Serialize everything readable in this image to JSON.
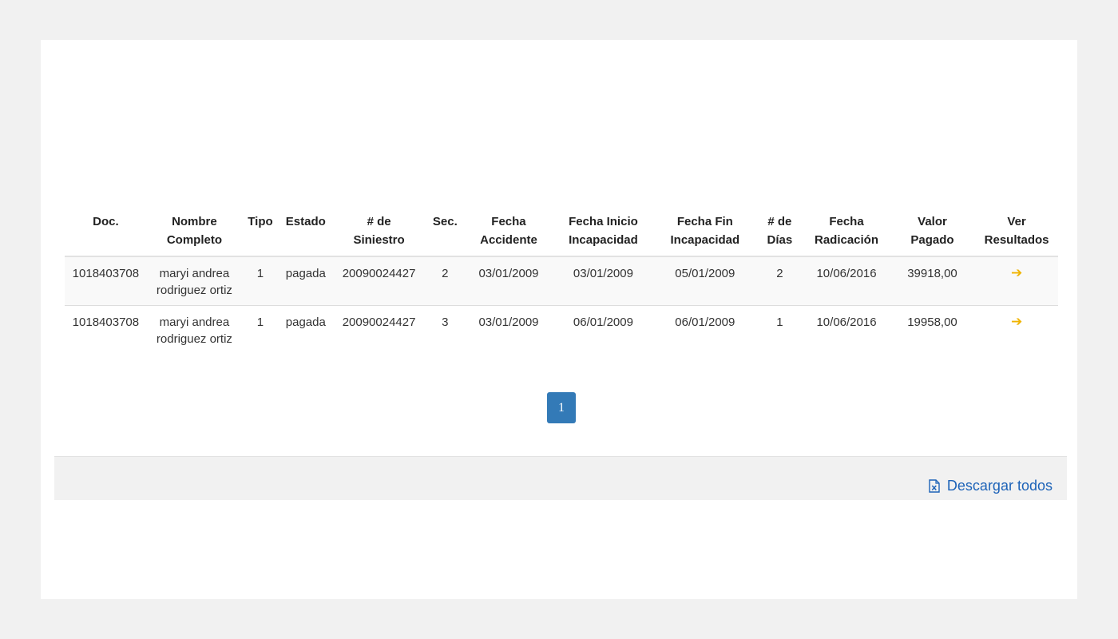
{
  "table": {
    "headers": [
      [
        "Doc.",
        ""
      ],
      [
        "Nombre",
        "Completo"
      ],
      [
        "Tipo",
        ""
      ],
      [
        "Estado",
        ""
      ],
      [
        "# de",
        "Siniestro"
      ],
      [
        "Sec.",
        ""
      ],
      [
        "Fecha",
        "Accidente"
      ],
      [
        "Fecha Inicio",
        "Incapacidad"
      ],
      [
        "Fecha Fin",
        "Incapacidad"
      ],
      [
        "# de",
        "Días"
      ],
      [
        "Fecha",
        "Radicación"
      ],
      [
        "Valor",
        "Pagado"
      ],
      [
        "Ver",
        "Resultados"
      ]
    ],
    "rows": [
      {
        "doc": "1018403708",
        "nombre_1": "maryi andrea",
        "nombre_2": "rodriguez ortiz",
        "tipo": "1",
        "estado": "pagada",
        "siniestro": "20090024427",
        "sec": "2",
        "fecha_accidente": "03/01/2009",
        "fecha_inicio": "03/01/2009",
        "fecha_fin": "05/01/2009",
        "dias": "2",
        "fecha_radicacion": "10/06/2016",
        "valor": "39918,00",
        "ver_icon": "➔"
      },
      {
        "doc": "1018403708",
        "nombre_1": "maryi andrea",
        "nombre_2": "rodriguez ortiz",
        "tipo": "1",
        "estado": "pagada",
        "siniestro": "20090024427",
        "sec": "3",
        "fecha_accidente": "03/01/2009",
        "fecha_inicio": "06/01/2009",
        "fecha_fin": "06/01/2009",
        "dias": "1",
        "fecha_radicacion": "10/06/2016",
        "valor": "19958,00",
        "ver_icon": "➔"
      }
    ]
  },
  "pagination": {
    "current": "1"
  },
  "footer": {
    "download_label": "Descargar todos",
    "download_icon": "excel-file-icon"
  },
  "colors": {
    "accent_blue": "#337ab7",
    "link_blue": "#1d63b8",
    "arrow_yellow": "#f0b400"
  }
}
